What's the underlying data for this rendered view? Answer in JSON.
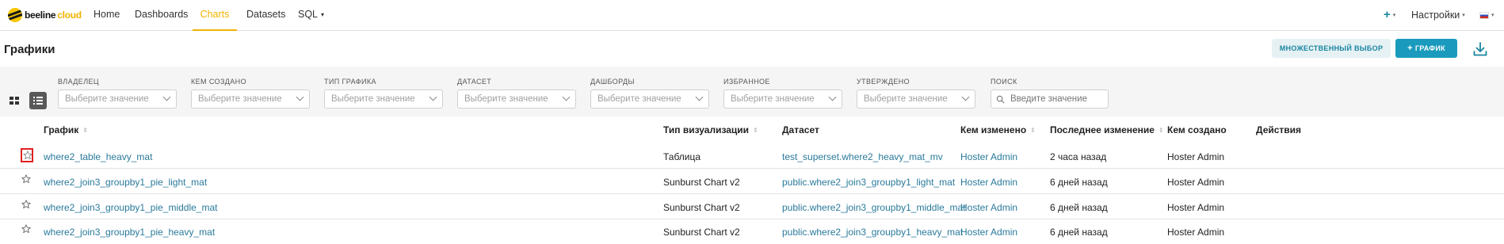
{
  "navbar": {
    "brand_name": "beeline",
    "brand_suffix": "cloud",
    "items": [
      {
        "label": "Home"
      },
      {
        "label": "Dashboards"
      },
      {
        "label": "Charts",
        "active": true
      },
      {
        "label": "Datasets"
      },
      {
        "label": "SQL",
        "has_dropdown": true
      }
    ],
    "settings_label": "Настройки",
    "accent_color": "#f0b400"
  },
  "header": {
    "title": "Графики",
    "bulk_select_label": "МНОЖЕСТВЕННЫЙ ВЫБОР",
    "add_chart_label": "ГРАФИК",
    "add_icon": "plus-icon",
    "download_icon": "download-icon"
  },
  "filters": {
    "view_modes": [
      "grid-view-icon",
      "list-view-icon"
    ],
    "selects": [
      {
        "label": "ВЛАДЕЛЕЦ",
        "placeholder": "Выберите значение"
      },
      {
        "label": "КЕМ СОЗДАНО",
        "placeholder": "Выберите значение"
      },
      {
        "label": "ТИП ГРАФИКА",
        "placeholder": "Выберите значение"
      },
      {
        "label": "ДАТАСЕТ",
        "placeholder": "Выберите значение"
      },
      {
        "label": "ДАШБОРДЫ",
        "placeholder": "Выберите значение"
      },
      {
        "label": "ИЗБРАННОЕ",
        "placeholder": "Выберите значение"
      },
      {
        "label": "УТВЕРЖДЕНО",
        "placeholder": "Выберите значение"
      }
    ],
    "search": {
      "label": "ПОИСК",
      "placeholder": "Введите значение"
    }
  },
  "table": {
    "columns": [
      {
        "label": "График",
        "sortable": true
      },
      {
        "label": "Тип визуализации",
        "sortable": true
      },
      {
        "label": "Датасет",
        "sortable": false
      },
      {
        "label": "Кем изменено",
        "sortable": true
      },
      {
        "label": "Последнее изменение",
        "sortable": true
      },
      {
        "label": "Кем создано",
        "sortable": false
      },
      {
        "label": "Действия",
        "sortable": false
      }
    ],
    "rows": [
      {
        "name": "where2_table_heavy_mat",
        "viz_type": "Таблица",
        "dataset": "test_superset.where2_heavy_mat_mv",
        "changed_by": "Hoster Admin",
        "changed_on": "2 часа назад",
        "created_by": "Hoster Admin",
        "starred_highlighted": true
      },
      {
        "name": "where2_join3_groupby1_pie_light_mat",
        "viz_type": "Sunburst Chart v2",
        "dataset": "public.where2_join3_groupby1_light_mat",
        "changed_by": "Hoster Admin",
        "changed_on": "6 дней назад",
        "created_by": "Hoster Admin",
        "starred_highlighted": false
      },
      {
        "name": "where2_join3_groupby1_pie_middle_mat",
        "viz_type": "Sunburst Chart v2",
        "dataset": "public.where2_join3_groupby1_middle_mat",
        "changed_by": "Hoster Admin",
        "changed_on": "6 дней назад",
        "created_by": "Hoster Admin",
        "starred_highlighted": false
      },
      {
        "name": "where2_join3_groupby1_pie_heavy_mat",
        "viz_type": "Sunburst Chart v2",
        "dataset": "public.where2_join3_groupby1_heavy_mat",
        "changed_by": "Hoster Admin",
        "changed_on": "6 дней назад",
        "created_by": "Hoster Admin",
        "starred_highlighted": false
      }
    ],
    "link_color": "#2a7a9b"
  }
}
